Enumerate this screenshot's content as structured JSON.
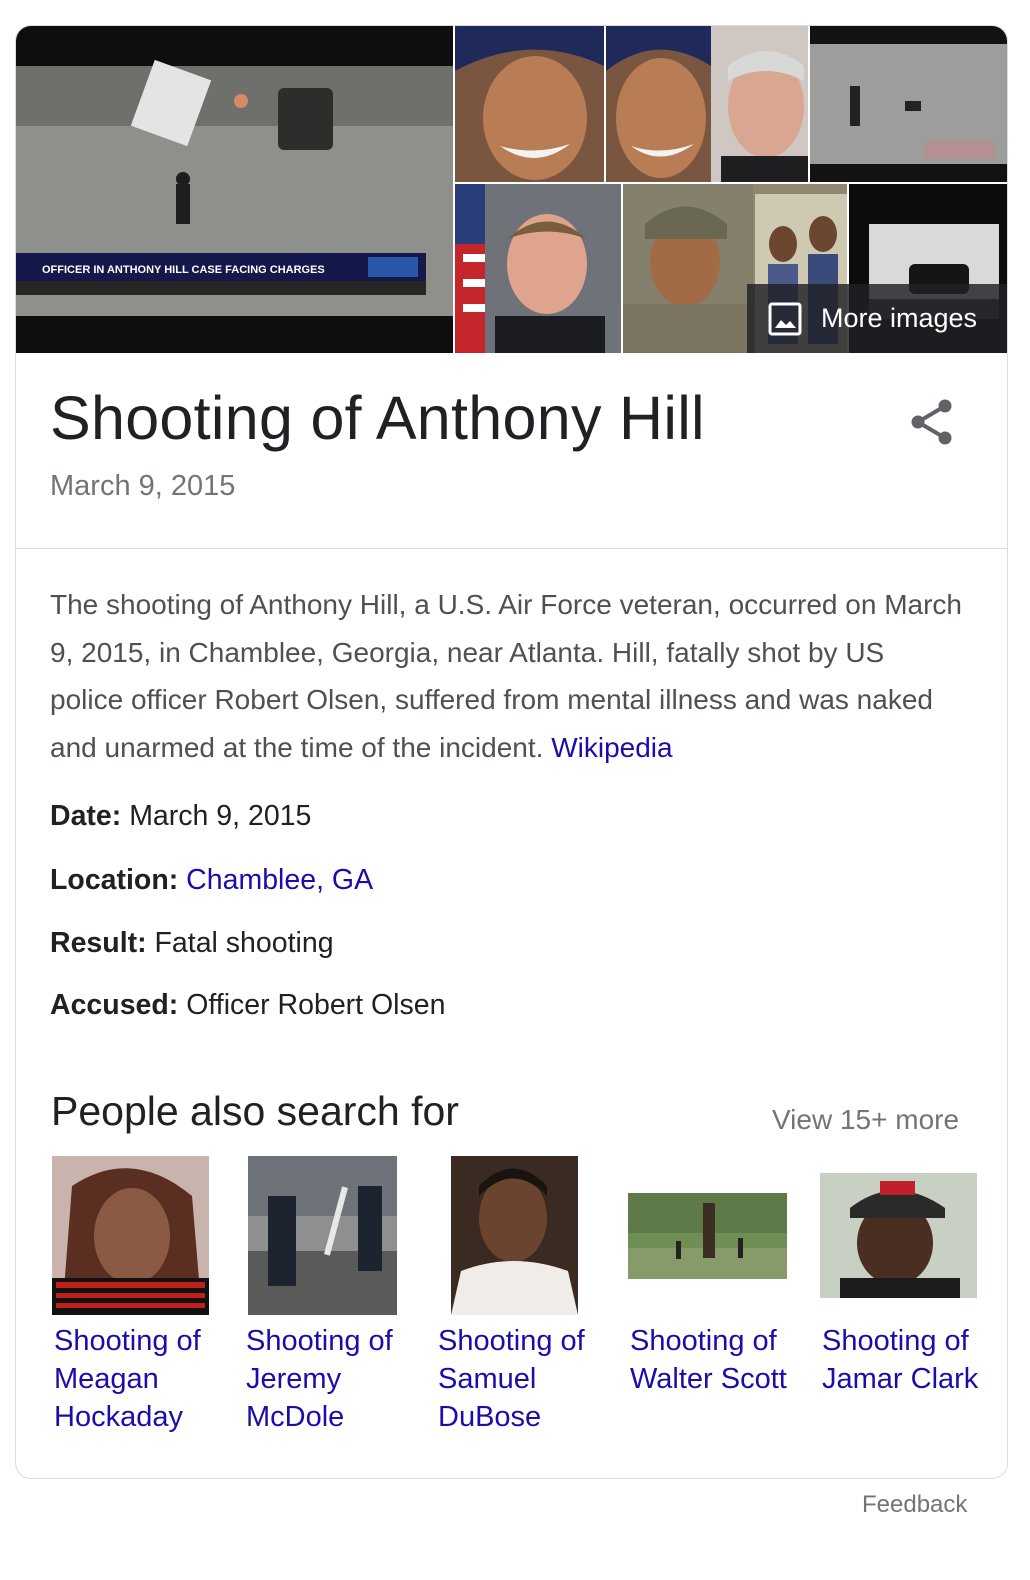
{
  "gallery": {
    "news_ticker": "OFFICER IN ANTHONY HILL CASE FACING CHARGES",
    "more_images_label": "More images",
    "more_images_icon": "image-icon"
  },
  "entity": {
    "title": "Shooting of Anthony Hill",
    "subtitle": "March 9, 2015",
    "share_icon": "share-icon"
  },
  "description": {
    "text": "The shooting of Anthony Hill, a U.S. Air Force veteran, occurred on March 9, 2015, in Chamblee, Georgia, near Atlanta. Hill, fatally shot by US police officer Robert Olsen, suffered from mental illness and was naked and unarmed at the time of the incident.",
    "source_link": "Wikipedia"
  },
  "facts": [
    {
      "label": "Date:",
      "value": "March 9, 2015",
      "is_link": false
    },
    {
      "label": "Location:",
      "value": "Chamblee, GA",
      "is_link": true
    },
    {
      "label": "Result:",
      "value": "Fatal shooting",
      "is_link": false
    },
    {
      "label": "Accused:",
      "value": "Officer Robert Olsen",
      "is_link": false
    }
  ],
  "people_also_search": {
    "title": "People also search for",
    "view_more": "View 15+ more",
    "items": [
      {
        "label": "Shooting of Meagan Hockaday"
      },
      {
        "label": "Shooting of Jeremy McDole"
      },
      {
        "label": "Shooting of Samuel DuBose"
      },
      {
        "label": "Shooting of Walter Scott"
      },
      {
        "label": "Shooting of Jamar Clark"
      }
    ]
  },
  "footer": {
    "feedback": "Feedback"
  },
  "colors": {
    "link": "#1a0dab",
    "title_text": "#202124",
    "muted_text": "#70757a",
    "body_text": "#4d5156",
    "border": "#dadce0"
  }
}
